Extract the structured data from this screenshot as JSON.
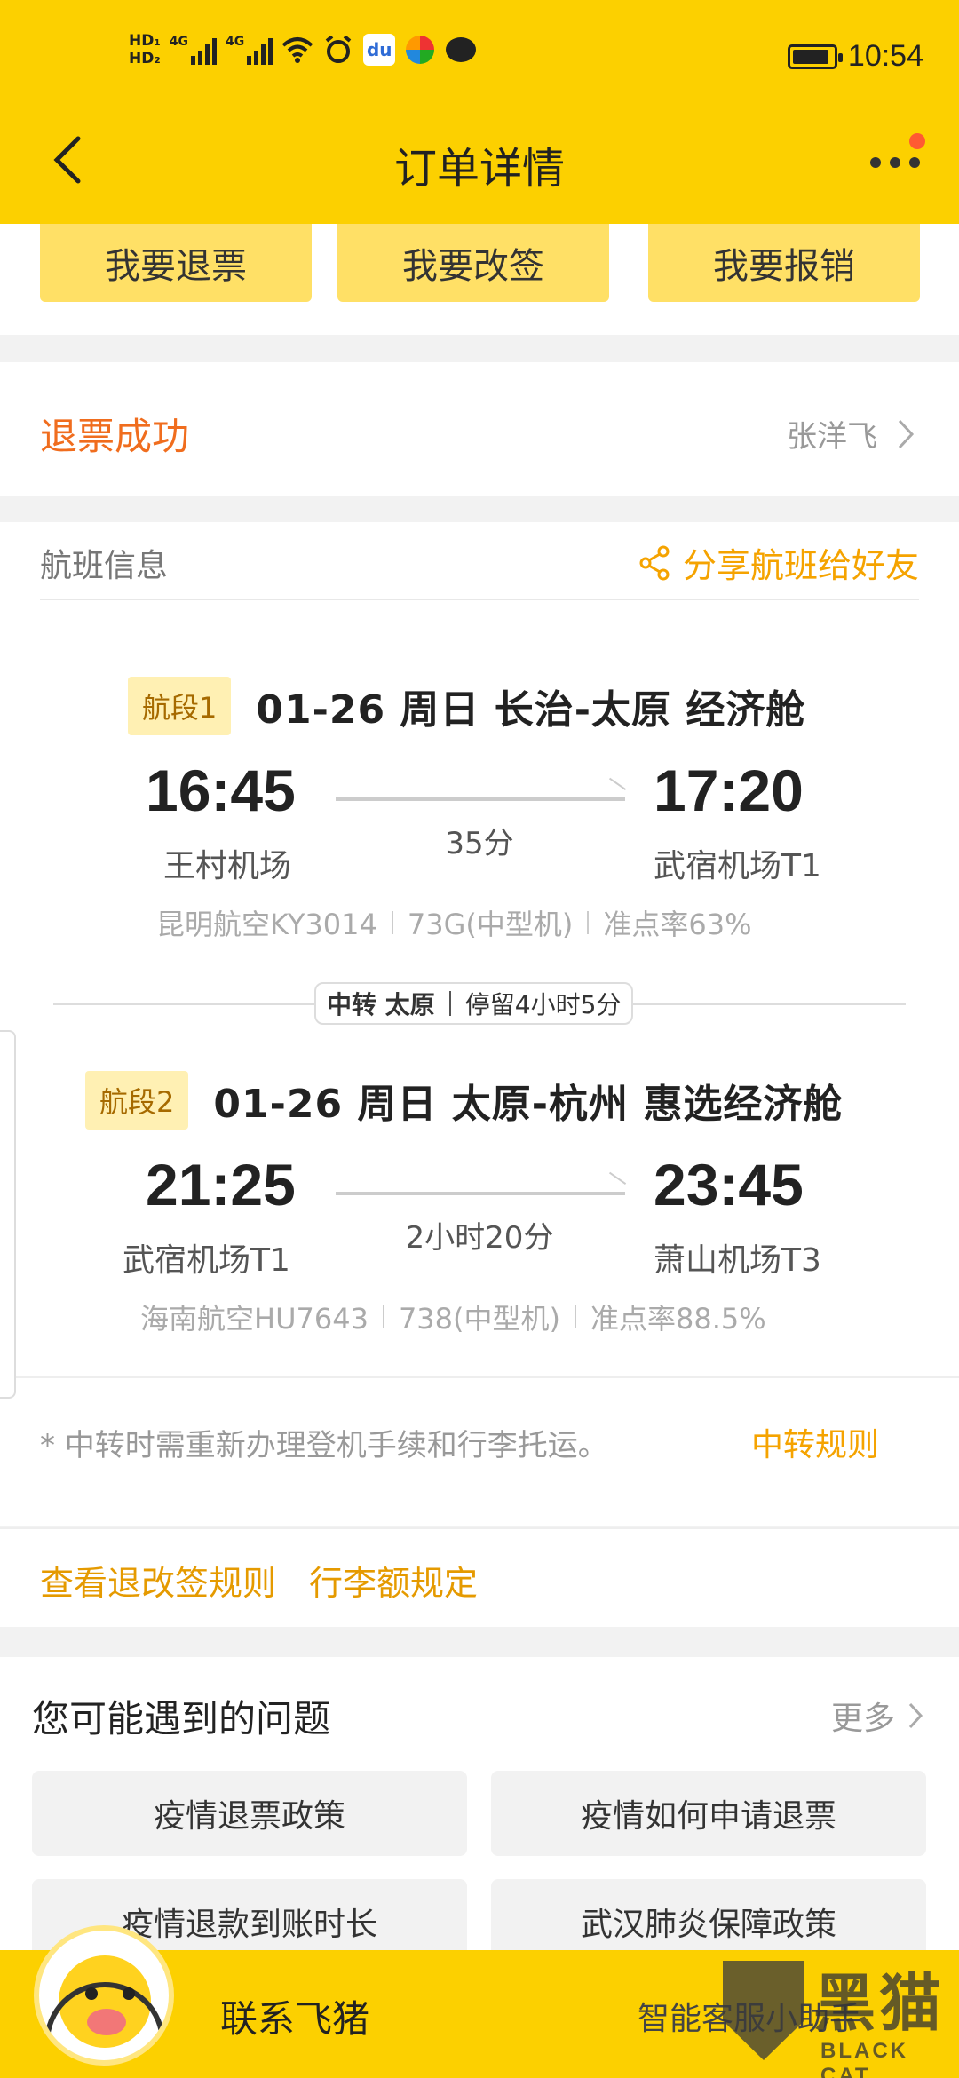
{
  "status_bar": {
    "hd1": "HD₁",
    "hd2": "HD₂",
    "net1": "4G",
    "net2": "4G",
    "baidu": "du",
    "battery_level": 0.9,
    "time": "10:54"
  },
  "header": {
    "title": "订单详情"
  },
  "actions": {
    "refund": "我要退票",
    "change": "我要改签",
    "reimburse": "我要报销"
  },
  "order_status": {
    "text": "退票成功",
    "passenger": "张洋飞"
  },
  "flight_card": {
    "label": "航班信息",
    "share": "分享航班给好友",
    "segments": [
      {
        "tag": "航段1",
        "title": "01-26  周日  长治-太原  经济舱",
        "dep_time": "16:45",
        "dep_airport": "王村机场",
        "duration": "35分",
        "arr_time": "17:20",
        "arr_airport": "武宿机场T1",
        "airline": "昆明航空KY3014",
        "aircraft": "73G(中型机)",
        "ontime": "准点率63%"
      },
      {
        "tag": "航段2",
        "title": "01-26  周日  太原-杭州  惠选经济舱",
        "dep_time": "21:25",
        "dep_airport": "武宿机场T1",
        "duration": "2小时20分",
        "arr_time": "23:45",
        "arr_airport": "萧山机场T3",
        "airline": "海南航空HU7643",
        "aircraft": "738(中型机)",
        "ontime": "准点率88.5%"
      }
    ],
    "transfer": {
      "city": "中转 太原",
      "stay": "停留4小时5分"
    },
    "note": "* 中转时需重新办理登机手续和行李托运。",
    "transfer_rule": "中转规则"
  },
  "rules": {
    "change_rules": "查看退改签规则",
    "baggage": "行李额规定"
  },
  "faq": {
    "title": "您可能遇到的问题",
    "more": "更多",
    "items": [
      "疫情退票政策",
      "疫情如何申请退票",
      "疫情退款到账时长",
      "武汉肺炎保障政策"
    ]
  },
  "bottom_bar": {
    "contact": "联系飞猪",
    "assistant": "智能客服小助手"
  },
  "watermark": {
    "cn": "黑猫",
    "en": "BLACK CAT"
  },
  "colors": {
    "brand_yellow": "#fcd000",
    "accent_orange": "#f5a300",
    "status_orange": "#f06d1e"
  }
}
